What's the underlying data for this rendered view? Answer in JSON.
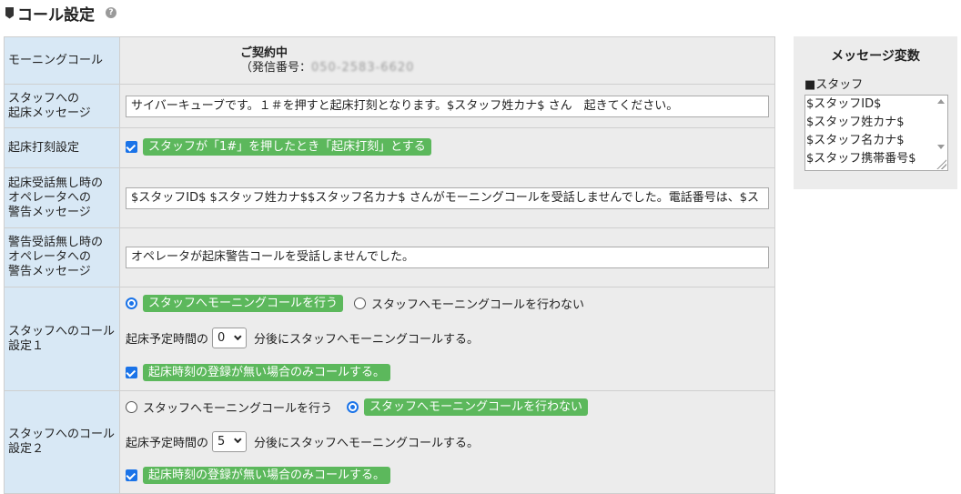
{
  "header": {
    "title": "コール設定",
    "help": "?"
  },
  "rows": {
    "morning_call": {
      "label": "モーニングコール",
      "status": "ご契約中",
      "number_prefix": "（発信番号：",
      "number_masked": "050-2583-6620"
    },
    "wakeup_message": {
      "label_line1": "スタッフへの",
      "label_line2": "起床メッセージ",
      "value": "サイバーキューブです。１＃を押すと起床打刻となります。$スタッフ姓カナ$ さん　起きてください。"
    },
    "clock_in_setting": {
      "label": "起床打刻設定",
      "checkbox_label": "スタッフが「1#」を押したとき「起床打刻」とする",
      "checked": true
    },
    "no_answer_operator_message": {
      "label_line1": "起床受話無し時の",
      "label_line2": "オペレータへの",
      "label_line3": "警告メッセージ",
      "value": "$スタッフID$ $スタッフ姓カナ$$スタッフ名カナ$ さんがモーニングコールを受話しませんでした。電話番号は、$ス"
    },
    "warning_no_answer_message": {
      "label_line1": "警告受話無し時の",
      "label_line2": "オペレータへの",
      "label_line3": "警告メッセージ",
      "value": "オペレータが起床警告コールを受話しませんでした。"
    },
    "call_setting_1": {
      "label_line1": "スタッフへのコール",
      "label_line2": "設定１",
      "option_on": "スタッフへモーニングコールを行う",
      "option_off": "スタッフへモーニングコールを行わない",
      "selected": "on",
      "time_prefix": "起床予定時間の",
      "minutes": "0",
      "time_suffix": "分後にスタッフへモーニングコールする。",
      "only_if_label": "起床時刻の登録が無い場合のみコールする。",
      "only_if_checked": true
    },
    "call_setting_2": {
      "label_line1": "スタッフへのコール",
      "label_line2": "設定２",
      "option_on": "スタッフへモーニングコールを行う",
      "option_off": "スタッフへモーニングコールを行わない",
      "selected": "off",
      "time_prefix": "起床予定時間の",
      "minutes": "5",
      "time_suffix": "分後にスタッフへモーニングコールする。",
      "only_if_label": "起床時刻の登録が無い場合のみコールする。",
      "only_if_checked": true
    }
  },
  "variables_panel": {
    "title": "メッセージ変数",
    "group": "■スタッフ",
    "items": [
      "$スタッフID$",
      "$スタッフ姓カナ$",
      "$スタッフ名カナ$",
      "$スタッフ携帯番号$"
    ]
  },
  "colors": {
    "label_bg": "#d8e8f5",
    "value_bg": "#ececec",
    "pill_green": "#5cb85c",
    "check_blue": "#1a73e8"
  }
}
